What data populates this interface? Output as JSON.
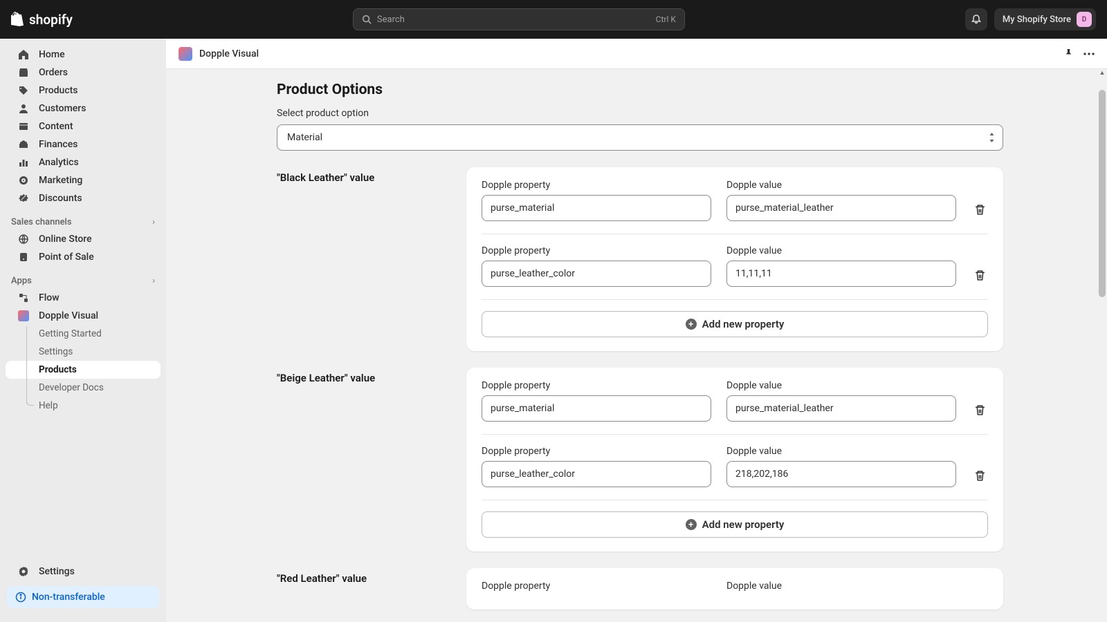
{
  "header": {
    "brand": "shopify",
    "search_placeholder": "Search",
    "search_shortcut": "Ctrl K",
    "store_name": "My Shopify Store",
    "store_initial": "D"
  },
  "sidebar": {
    "nav": [
      {
        "label": "Home",
        "icon": "home"
      },
      {
        "label": "Orders",
        "icon": "orders"
      },
      {
        "label": "Products",
        "icon": "products"
      },
      {
        "label": "Customers",
        "icon": "customers"
      },
      {
        "label": "Content",
        "icon": "content"
      },
      {
        "label": "Finances",
        "icon": "finances"
      },
      {
        "label": "Analytics",
        "icon": "analytics"
      },
      {
        "label": "Marketing",
        "icon": "marketing"
      },
      {
        "label": "Discounts",
        "icon": "discounts"
      }
    ],
    "sales_channels_label": "Sales channels",
    "sales_channels": [
      {
        "label": "Online Store",
        "icon": "online-store"
      },
      {
        "label": "Point of Sale",
        "icon": "pos"
      }
    ],
    "apps_label": "Apps",
    "apps": [
      {
        "label": "Flow",
        "icon": "flow"
      },
      {
        "label": "Dopple Visual",
        "icon": "dopple"
      }
    ],
    "dopple_sub": [
      {
        "label": "Getting Started"
      },
      {
        "label": "Settings"
      },
      {
        "label": "Products",
        "active": true
      },
      {
        "label": "Developer Docs"
      },
      {
        "label": "Help"
      }
    ],
    "settings_label": "Settings",
    "non_transferable": "Non-transferable"
  },
  "page": {
    "app_title": "Dopple Visual",
    "section_heading": "Product Options",
    "select_label": "Select product option",
    "select_value": "Material",
    "add_new_label": "Add new property",
    "property_label": "Dopple property",
    "value_label": "Dopple value",
    "option_values": [
      {
        "title": "\"Black Leather\" value",
        "props": [
          {
            "prop": "purse_material",
            "val": "purse_material_leather"
          },
          {
            "prop": "purse_leather_color",
            "val": "11,11,11"
          }
        ]
      },
      {
        "title": "\"Beige Leather\" value",
        "props": [
          {
            "prop": "purse_material",
            "val": "purse_material_leather"
          },
          {
            "prop": "purse_leather_color",
            "val": "218,202,186"
          }
        ]
      },
      {
        "title": "\"Red Leather\" value",
        "props": [
          {
            "prop": "",
            "val": ""
          }
        ]
      }
    ]
  }
}
